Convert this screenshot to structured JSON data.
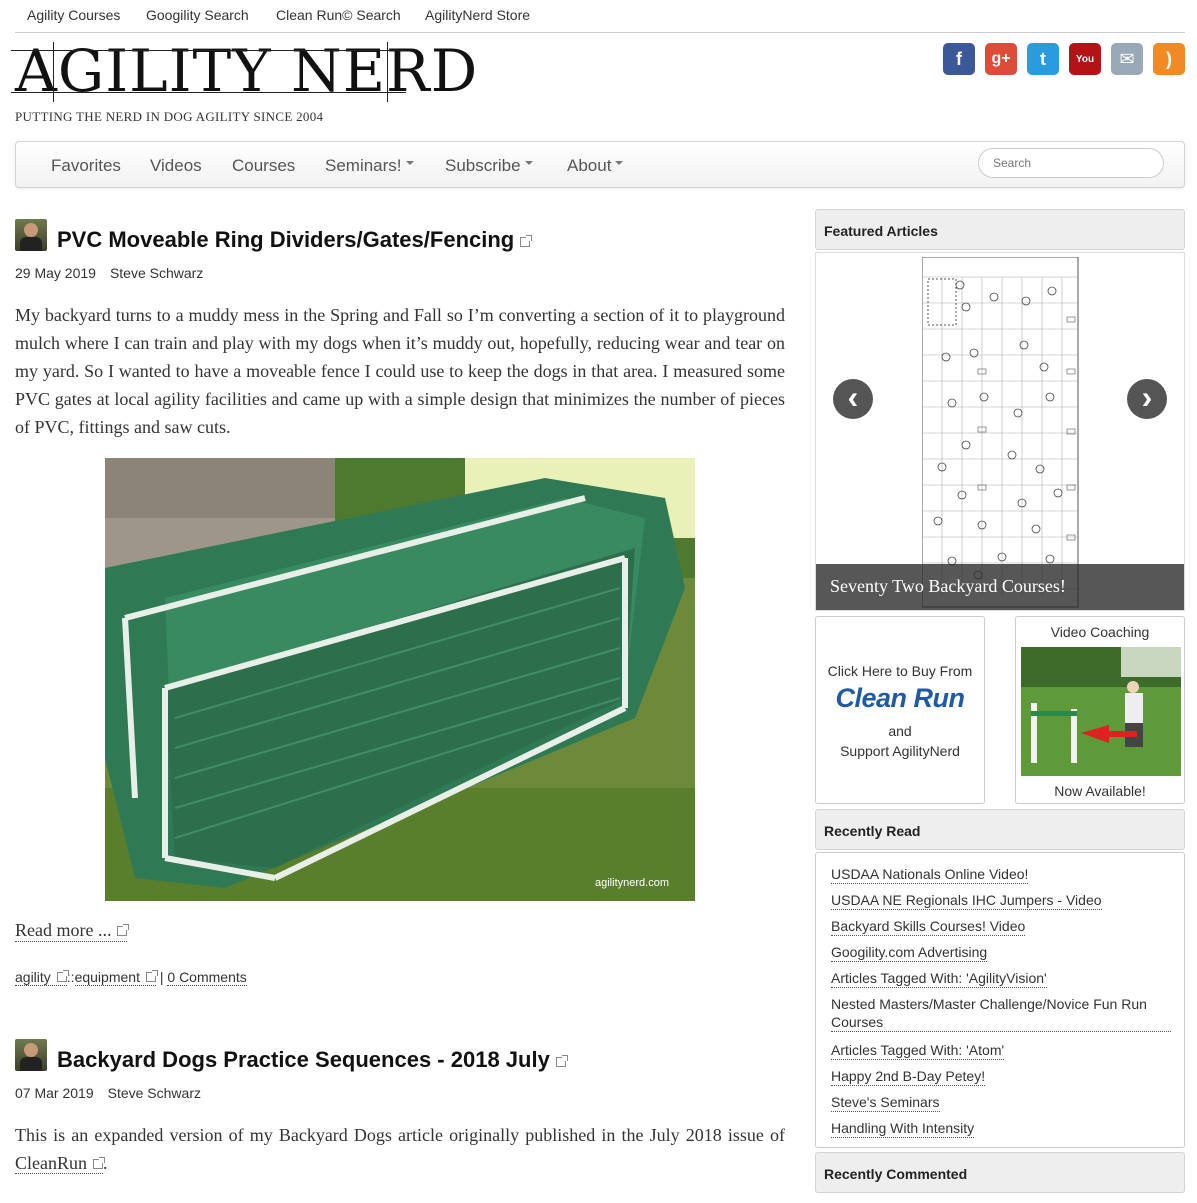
{
  "top_links": [
    "Agility Courses",
    "Googility Search",
    "Clean Run© Search",
    "AgilityNerd Store"
  ],
  "logo": {
    "text": "AGILITY NERD",
    "tagline": "PUTTING THE NERD IN DOG AGILITY SINCE 2004"
  },
  "social_icons": [
    {
      "name": "facebook-icon",
      "color": "#3b5998",
      "glyph": "f"
    },
    {
      "name": "google-plus-icon",
      "color": "#dd4b39",
      "glyph": "g+"
    },
    {
      "name": "twitter-icon",
      "color": "#2a9be0",
      "glyph": "t"
    },
    {
      "name": "youtube-icon",
      "color": "#b31217",
      "glyph": "You"
    },
    {
      "name": "email-icon",
      "color": "#9aa9b8",
      "glyph": "✉"
    },
    {
      "name": "rss-icon",
      "color": "#f08a24",
      "glyph": ")"
    }
  ],
  "nav": {
    "items": [
      "Favorites",
      "Videos",
      "Courses",
      "Seminars!",
      "Subscribe",
      "About"
    ],
    "search_placeholder": "Search"
  },
  "articles": [
    {
      "title": "PVC Moveable Ring Dividers/Gates/Fencing",
      "date": "29 May 2019",
      "author": "Steve Schwarz",
      "body": "My backyard turns to a muddy mess in the Spring and Fall so I’m converting a section of it to playground mulch where I can train and play with my dogs when it’s muddy out, hopefully, reducing wear and tear on my yard. So I wanted to have a moveable fence I could use to keep the dogs in that area. I measured some PVC gates at local agility facilities and came up with a simple design that minimizes the number of pieces of PVC, fittings and saw cuts.",
      "photo_watermark": "agilitynerd.com",
      "read_more": "Read more ...",
      "tag1": "agility",
      "tag_sep": "::",
      "tag2": "equipment",
      "pipe": "|",
      "comments": "0 Comments"
    },
    {
      "title": "Backyard Dogs Practice Sequences - 2018 July",
      "date": "07 Mar 2019",
      "author": "Steve Schwarz",
      "body_prefix": "This is an expanded version of my Backyard Dogs article originally published in the July 2018 issue of",
      "body_link": "CleanRun",
      "body_suffix": "."
    }
  ],
  "sidebar": {
    "featured_heading": "Featured Articles",
    "featured_caption": "Seventy Two Backyard Courses!",
    "cleanrun": {
      "line1": "Click Here to Buy From",
      "logo": "Clean Run",
      "line2": "and",
      "line3": "Support AgilityNerd"
    },
    "video": {
      "title": "Video Coaching",
      "footer": "Now Available!"
    },
    "recently_read_heading": "Recently Read",
    "recently_read": [
      "USDAA Nationals Online Video!",
      "USDAA NE Regionals IHC Jumpers - Video",
      "Backyard Skills Courses! Video",
      "Googility.com Advertising",
      "Articles Tagged With: 'AgilityVision'",
      "Nested Masters/Master Challenge/Novice Fun Run Courses",
      "Articles Tagged With: 'Atom'",
      "Happy 2nd B-Day Petey!",
      "Steve's Seminars",
      "Handling With Intensity"
    ],
    "recently_commented_heading": "Recently Commented"
  }
}
